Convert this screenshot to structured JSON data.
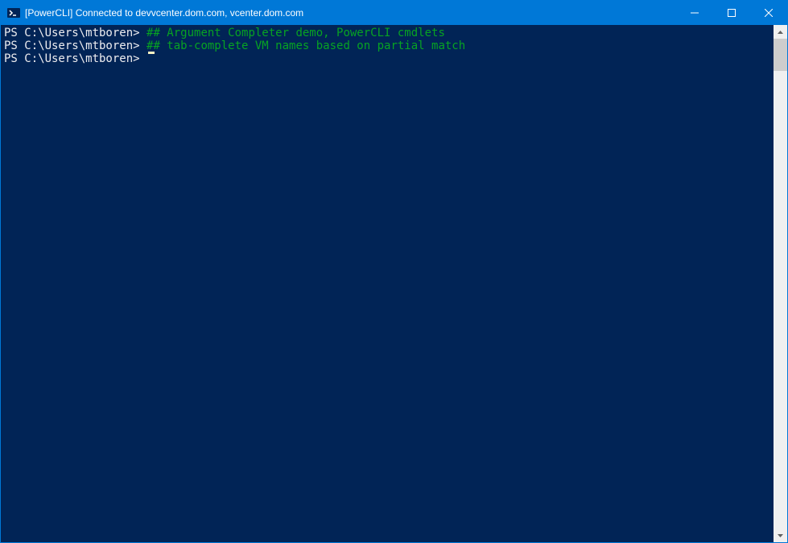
{
  "window": {
    "title": "[PowerCLI] Connected to devvcenter.dom.com, vcenter.dom.com"
  },
  "terminal": {
    "lines": [
      {
        "prompt": "PS C:\\Users\\mtboren> ",
        "text": "## Argument Completer demo, PowerCLI cmdlets",
        "textClass": "comment"
      },
      {
        "prompt": "PS C:\\Users\\mtboren> ",
        "text": "## tab-complete VM names based on partial match",
        "textClass": "comment"
      },
      {
        "prompt": "PS C:\\Users\\mtboren> ",
        "text": "",
        "cursor": true
      }
    ]
  },
  "colors": {
    "titlebar": "#0078d7",
    "terminalBg": "#012456",
    "promptColor": "#eeedf0",
    "commentColor": "#07a323"
  }
}
